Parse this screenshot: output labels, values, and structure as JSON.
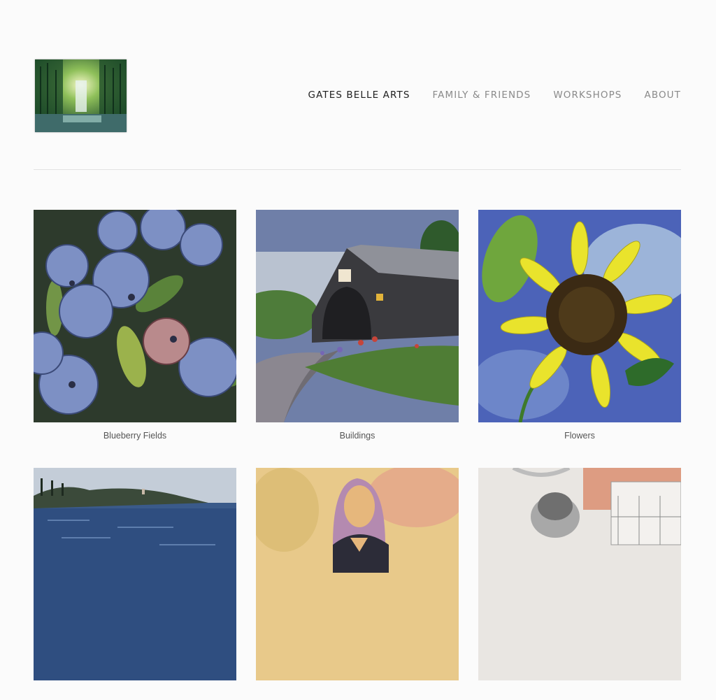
{
  "site": {
    "logo_alt": "Forest waterfall painting logo"
  },
  "nav": {
    "items": [
      {
        "label": "GATES BELLE ARTS",
        "active": true
      },
      {
        "label": "FAMILY & FRIENDS",
        "active": false
      },
      {
        "label": "WORKSHOPS",
        "active": false
      },
      {
        "label": "ABOUT",
        "active": false
      }
    ]
  },
  "gallery": {
    "items": [
      {
        "caption": "Blueberry Fields"
      },
      {
        "caption": "Buildings"
      },
      {
        "caption": "Flowers"
      },
      {
        "caption": ""
      },
      {
        "caption": ""
      },
      {
        "caption": ""
      }
    ]
  }
}
